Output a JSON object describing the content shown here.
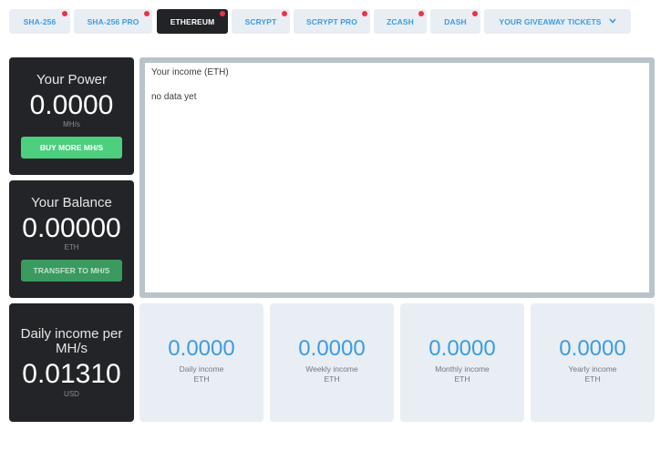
{
  "tabs": [
    {
      "label": "SHA-256",
      "dot": true
    },
    {
      "label": "SHA-256 PRO",
      "dot": true
    },
    {
      "label": "ETHEREUM",
      "dot": true,
      "active": true
    },
    {
      "label": "SCRYPT",
      "dot": true
    },
    {
      "label": "SCRYPT PRO",
      "dot": true
    },
    {
      "label": "ZCASH",
      "dot": true
    },
    {
      "label": "DASH",
      "dot": true
    },
    {
      "label": "YOUR GIVEAWAY TICKETS",
      "dot": false
    }
  ],
  "power": {
    "title": "Your Power",
    "value": "0.0000",
    "unit": "MH/s",
    "button": "BUY MORE MH/S"
  },
  "balance": {
    "title": "Your Balance",
    "value": "0.00000",
    "unit": "ETH",
    "button": "TRANSFER TO MH/S"
  },
  "daily_per": {
    "title": "Daily income per MH/s",
    "value": "0.01310",
    "unit": "USD"
  },
  "income_chart": {
    "title": "Your income (ETH)",
    "empty_text": "no data yet"
  },
  "stats": [
    {
      "value": "0.0000",
      "label": "Daily income",
      "unit": "ETH"
    },
    {
      "value": "0.0000",
      "label": "Weekly income",
      "unit": "ETH"
    },
    {
      "value": "0.0000",
      "label": "Monthly income",
      "unit": "ETH"
    },
    {
      "value": "0.0000",
      "label": "Yearly income",
      "unit": "ETH"
    }
  ],
  "colors": {
    "accent": "#3d9be0",
    "dark_card": "#222427",
    "light_tile": "#e8eef3",
    "notification_dot": "#e8334a",
    "buy_button": "#4ccf7f",
    "transfer_button": "#3a9a5f",
    "chart_border": "#b8c4c9"
  },
  "icons": {
    "tickets_dropdown": "chevron-down-icon"
  }
}
